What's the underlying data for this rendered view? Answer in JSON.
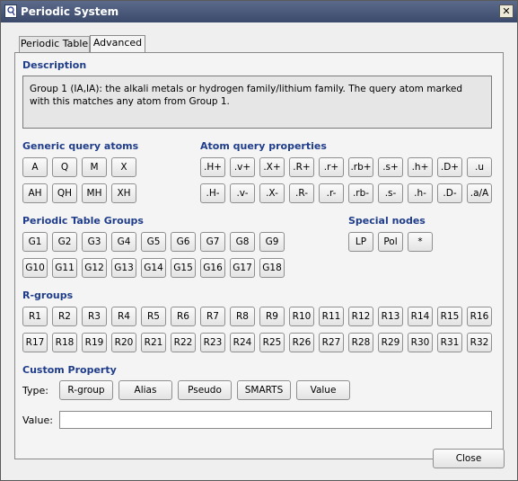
{
  "window": {
    "title": "Periodic System"
  },
  "tabs": [
    {
      "label": "Periodic Table",
      "active": false
    },
    {
      "label": "Advanced",
      "active": true
    }
  ],
  "description": {
    "heading": "Description",
    "text": "Group 1 (IA,IA): the alkali metals or hydrogen family/lithium family. The query atom marked with this matches any atom from Group 1."
  },
  "generic": {
    "heading": "Generic query atoms",
    "buttons": [
      "A",
      "Q",
      "M",
      "X",
      "AH",
      "QH",
      "MH",
      "XH"
    ]
  },
  "atomprops": {
    "heading": "Atom query properties",
    "buttons": [
      ".H+",
      ".v+",
      ".X+",
      ".R+",
      ".r+",
      ".rb+",
      ".s+",
      ".h+",
      ".D+",
      ".u",
      ".H-",
      ".v-",
      ".X-",
      ".R-",
      ".r-",
      ".rb-",
      ".s-",
      ".h-",
      ".D-",
      ".a/A"
    ]
  },
  "groups": {
    "heading": "Periodic Table Groups",
    "buttons": [
      "G1",
      "G2",
      "G3",
      "G4",
      "G5",
      "G6",
      "G7",
      "G8",
      "G9",
      "G10",
      "G11",
      "G12",
      "G13",
      "G14",
      "G15",
      "G16",
      "G17",
      "G18"
    ]
  },
  "special": {
    "heading": "Special nodes",
    "buttons": [
      "LP",
      "Pol",
      "*"
    ]
  },
  "rgroups": {
    "heading": "R-groups",
    "buttons": [
      "R1",
      "R2",
      "R3",
      "R4",
      "R5",
      "R6",
      "R7",
      "R8",
      "R9",
      "R10",
      "R11",
      "R12",
      "R13",
      "R14",
      "R15",
      "R16",
      "R17",
      "R18",
      "R19",
      "R20",
      "R21",
      "R22",
      "R23",
      "R24",
      "R25",
      "R26",
      "R27",
      "R28",
      "R29",
      "R30",
      "R31",
      "R32"
    ]
  },
  "custom": {
    "heading": "Custom Property",
    "type_label": "Type:",
    "type_buttons": [
      "R-group",
      "Alias",
      "Pseudo",
      "SMARTS",
      "Value"
    ],
    "value_label": "Value:",
    "value": ""
  },
  "footer": {
    "close_label": "Close"
  }
}
